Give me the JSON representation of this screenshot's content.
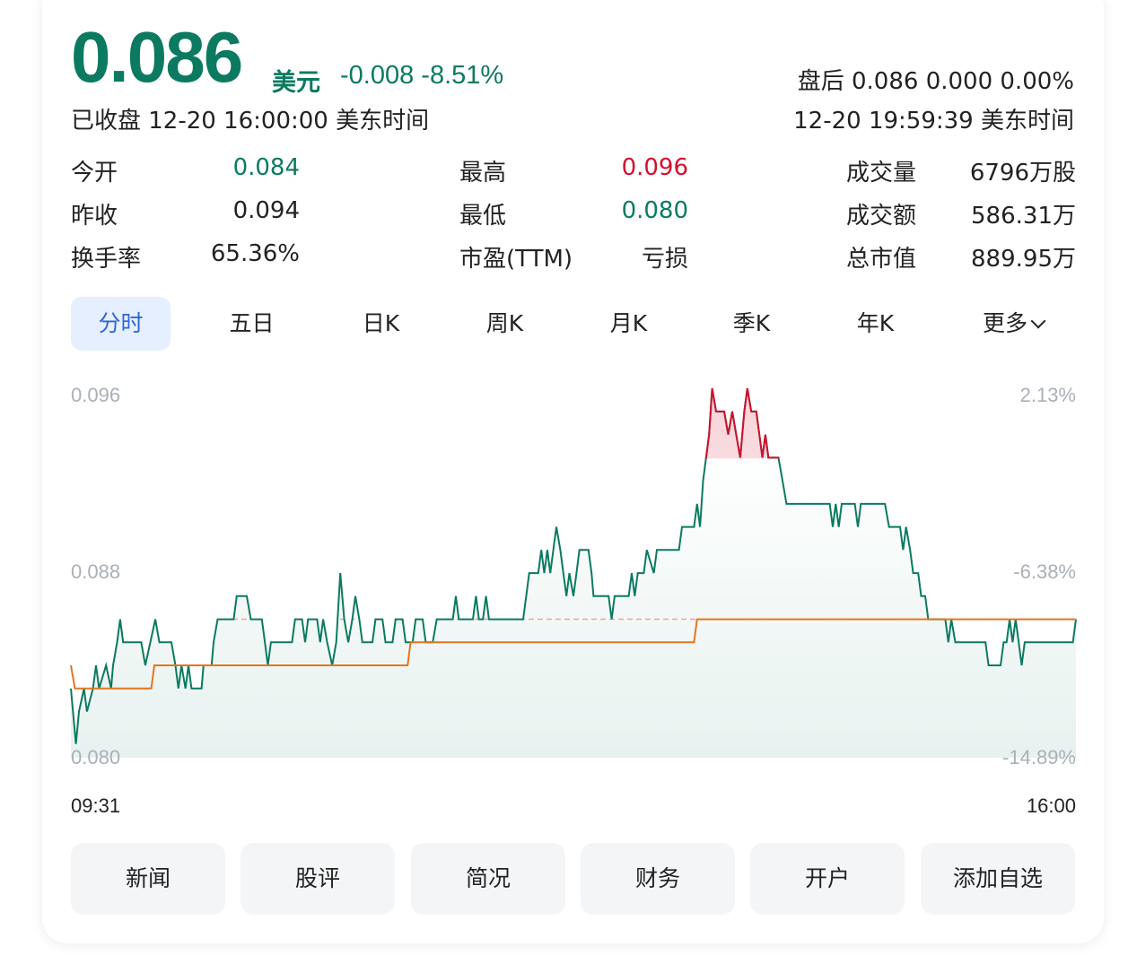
{
  "quote": {
    "price": "0.086",
    "currency": "美元",
    "change": "-0.008",
    "change_pct": "-8.51%",
    "status": "已收盘 12-20 16:00:00 美东时间",
    "after_hours": "盘后 0.086 0.000 0.00%",
    "after_hours_time": "12-20 19:59:39 美东时间"
  },
  "stats": [
    {
      "label": "今开",
      "value": "0.084",
      "color": "green"
    },
    {
      "label": "昨收",
      "value": "0.094",
      "color": "normal"
    },
    {
      "label": "换手率",
      "value": "65.36%",
      "color": "normal"
    },
    {
      "label": "最高",
      "value": "0.096",
      "color": "red"
    },
    {
      "label": "最低",
      "value": "0.080",
      "color": "green"
    },
    {
      "label": "市盈(TTM)",
      "value": "亏损",
      "color": "normal"
    },
    {
      "label": "成交量",
      "value": "6796万股",
      "color": "normal"
    },
    {
      "label": "成交额",
      "value": "586.31万",
      "color": "normal"
    },
    {
      "label": "总市值",
      "value": "889.95万",
      "color": "normal"
    }
  ],
  "tabs": [
    "分时",
    "五日",
    "日K",
    "周K",
    "月K",
    "季K",
    "年K",
    "更多"
  ],
  "active_tab": "分时",
  "chart_data": {
    "type": "line",
    "y_left_ticks": [
      "0.096",
      "0.088",
      "0.080"
    ],
    "y_right_ticks": [
      "2.13%",
      "-6.38%",
      "-14.89%"
    ],
    "x_start": "09:31",
    "x_end": "16:00",
    "ylim": [
      0.08,
      0.0962
    ],
    "prev_close_line": 0.086,
    "colors": {
      "price_line": "#0b7a60",
      "above_line": "#d3102d",
      "avg_line": "#e6741d",
      "prev_close": "#f0a0a0"
    },
    "price_series": [
      [
        0,
        0.083
      ],
      [
        0.5,
        0.0806
      ],
      [
        0.8,
        0.082
      ],
      [
        1.3,
        0.083
      ],
      [
        1.6,
        0.082
      ],
      [
        2.2,
        0.083
      ],
      [
        2.5,
        0.084
      ],
      [
        2.8,
        0.083
      ],
      [
        3.5,
        0.084
      ],
      [
        4,
        0.083
      ],
      [
        4.2,
        0.084
      ],
      [
        4.6,
        0.085
      ],
      [
        4.9,
        0.086
      ],
      [
        5.2,
        0.085
      ],
      [
        7.0,
        0.085
      ],
      [
        7.4,
        0.084
      ],
      [
        7.9,
        0.085
      ],
      [
        8.4,
        0.086
      ],
      [
        8.8,
        0.085
      ],
      [
        10,
        0.085
      ],
      [
        10.4,
        0.084
      ],
      [
        10.7,
        0.083
      ],
      [
        11,
        0.084
      ],
      [
        11.4,
        0.083
      ],
      [
        11.7,
        0.084
      ],
      [
        12,
        0.083
      ],
      [
        13,
        0.083
      ],
      [
        13.2,
        0.084
      ],
      [
        14,
        0.084
      ],
      [
        14.2,
        0.085
      ],
      [
        14.6,
        0.086
      ],
      [
        16.2,
        0.086
      ],
      [
        16.5,
        0.087
      ],
      [
        17.5,
        0.087
      ],
      [
        17.9,
        0.086
      ],
      [
        19,
        0.086
      ],
      [
        19.3,
        0.085
      ],
      [
        19.6,
        0.084
      ],
      [
        19.9,
        0.085
      ],
      [
        22,
        0.085
      ],
      [
        22.3,
        0.086
      ],
      [
        23,
        0.086
      ],
      [
        23.3,
        0.085
      ],
      [
        23.6,
        0.086
      ],
      [
        24.5,
        0.086
      ],
      [
        24.8,
        0.085
      ],
      [
        25.1,
        0.086
      ],
      [
        25.5,
        0.085
      ],
      [
        26,
        0.084
      ],
      [
        26.4,
        0.085
      ],
      [
        26.8,
        0.088
      ],
      [
        27.2,
        0.086
      ],
      [
        27.6,
        0.085
      ],
      [
        28,
        0.086
      ],
      [
        28.3,
        0.087
      ],
      [
        28.7,
        0.086
      ],
      [
        29,
        0.085
      ],
      [
        30,
        0.085
      ],
      [
        30.3,
        0.086
      ],
      [
        31,
        0.086
      ],
      [
        31.3,
        0.085
      ],
      [
        32,
        0.085
      ],
      [
        32.3,
        0.086
      ],
      [
        33,
        0.086
      ],
      [
        33.3,
        0.085
      ],
      [
        34,
        0.085
      ],
      [
        34.3,
        0.086
      ],
      [
        35,
        0.086
      ],
      [
        35.3,
        0.085
      ],
      [
        36,
        0.085
      ],
      [
        36.4,
        0.086
      ],
      [
        38,
        0.086
      ],
      [
        38.3,
        0.087
      ],
      [
        38.6,
        0.086
      ],
      [
        40,
        0.086
      ],
      [
        40.3,
        0.087
      ],
      [
        40.6,
        0.086
      ],
      [
        41,
        0.086
      ],
      [
        41.3,
        0.087
      ],
      [
        41.6,
        0.086
      ],
      [
        45,
        0.086
      ],
      [
        45.3,
        0.087
      ],
      [
        45.6,
        0.088
      ],
      [
        46.5,
        0.088
      ],
      [
        46.8,
        0.089
      ],
      [
        47.1,
        0.088
      ],
      [
        47.4,
        0.089
      ],
      [
        47.7,
        0.088
      ],
      [
        48,
        0.089
      ],
      [
        48.3,
        0.09
      ],
      [
        48.7,
        0.089
      ],
      [
        49,
        0.088
      ],
      [
        49.3,
        0.087
      ],
      [
        49.6,
        0.088
      ],
      [
        50,
        0.087
      ],
      [
        50.3,
        0.088
      ],
      [
        50.6,
        0.089
      ],
      [
        51.5,
        0.089
      ],
      [
        51.8,
        0.088
      ],
      [
        52,
        0.087
      ],
      [
        53.5,
        0.087
      ],
      [
        53.8,
        0.086
      ],
      [
        54.1,
        0.087
      ],
      [
        55.5,
        0.087
      ],
      [
        55.8,
        0.088
      ],
      [
        56.1,
        0.087
      ],
      [
        56.4,
        0.088
      ],
      [
        57,
        0.088
      ],
      [
        57.3,
        0.089
      ],
      [
        58,
        0.088
      ],
      [
        58.3,
        0.089
      ],
      [
        60.5,
        0.089
      ],
      [
        60.8,
        0.09
      ],
      [
        62,
        0.09
      ],
      [
        62.3,
        0.091
      ],
      [
        62.6,
        0.09
      ],
      [
        62.9,
        0.092
      ],
      [
        63.5,
        0.094
      ],
      [
        63.8,
        0.096
      ],
      [
        64.2,
        0.095
      ],
      [
        65,
        0.095
      ],
      [
        65.4,
        0.094
      ],
      [
        65.8,
        0.095
      ],
      [
        66.2,
        0.094
      ],
      [
        66.6,
        0.093
      ],
      [
        67,
        0.095
      ],
      [
        67.3,
        0.096
      ],
      [
        67.7,
        0.095
      ],
      [
        68.2,
        0.095
      ],
      [
        68.5,
        0.094
      ],
      [
        68.8,
        0.093
      ],
      [
        69.1,
        0.094
      ],
      [
        69.4,
        0.093
      ],
      [
        70,
        0.093
      ],
      [
        70.4,
        0.093
      ],
      [
        70.8,
        0.092
      ],
      [
        71.2,
        0.091
      ],
      [
        72,
        0.091
      ],
      [
        75.5,
        0.091
      ],
      [
        75.8,
        0.09
      ],
      [
        76.1,
        0.091
      ],
      [
        76.4,
        0.09
      ],
      [
        76.7,
        0.091
      ],
      [
        78,
        0.091
      ],
      [
        78.3,
        0.09
      ],
      [
        78.6,
        0.091
      ],
      [
        81,
        0.091
      ],
      [
        81.4,
        0.09
      ],
      [
        82.5,
        0.09
      ],
      [
        82.8,
        0.089
      ],
      [
        83.1,
        0.09
      ],
      [
        83.5,
        0.089
      ],
      [
        83.8,
        0.088
      ],
      [
        84.3,
        0.088
      ],
      [
        84.6,
        0.087
      ],
      [
        85,
        0.087
      ],
      [
        85.3,
        0.086
      ],
      [
        87,
        0.086
      ],
      [
        87.3,
        0.085
      ],
      [
        87.6,
        0.086
      ],
      [
        88,
        0.085
      ],
      [
        91,
        0.085
      ],
      [
        91.3,
        0.084
      ],
      [
        92.5,
        0.084
      ],
      [
        92.8,
        0.085
      ],
      [
        93.1,
        0.085
      ],
      [
        93.4,
        0.086
      ],
      [
        93.7,
        0.085
      ],
      [
        94,
        0.086
      ],
      [
        94.3,
        0.085
      ],
      [
        94.6,
        0.084
      ],
      [
        94.9,
        0.085
      ],
      [
        99.7,
        0.085
      ],
      [
        100,
        0.086
      ]
    ],
    "avg_series": [
      [
        0,
        0.084
      ],
      [
        0.4,
        0.083
      ],
      [
        8,
        0.083
      ],
      [
        8.3,
        0.084
      ],
      [
        33.5,
        0.084
      ],
      [
        33.8,
        0.085
      ],
      [
        62,
        0.085
      ],
      [
        62.3,
        0.086
      ],
      [
        100,
        0.086
      ]
    ]
  },
  "buttons": [
    "新闻",
    "股评",
    "简况",
    "财务",
    "开户",
    "添加自选"
  ]
}
